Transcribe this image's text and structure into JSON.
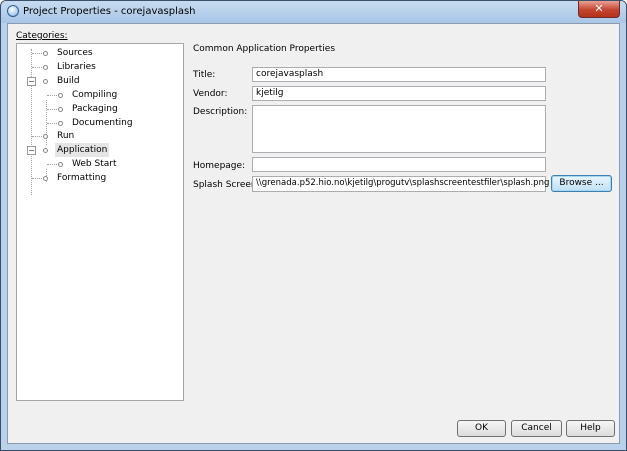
{
  "window": {
    "title": "Project Properties - corejavasplash",
    "close_glyph": "✕"
  },
  "categories": {
    "label": "Categories:",
    "items": [
      {
        "label": "Sources"
      },
      {
        "label": "Libraries"
      },
      {
        "label": "Build"
      },
      {
        "label": "Compiling"
      },
      {
        "label": "Packaging"
      },
      {
        "label": "Documenting"
      },
      {
        "label": "Run"
      },
      {
        "label": "Application"
      },
      {
        "label": "Web Start"
      },
      {
        "label": "Formatting"
      }
    ]
  },
  "panel": {
    "title": "Common Application Properties",
    "fields": {
      "title": {
        "label": "Title:",
        "value": "corejavasplash"
      },
      "vendor": {
        "label": "Vendor:",
        "value": "kjetilg"
      },
      "description": {
        "label": "Description:",
        "value": ""
      },
      "homepage": {
        "label": "Homepage:",
        "value": ""
      },
      "splash": {
        "label": "Splash Screen:",
        "value": "\\\\grenada.p52.hio.no\\kjetilg\\progutv\\splashscreentestfiler\\splash.png"
      }
    },
    "browse_label": "Browse ..."
  },
  "buttons": {
    "ok": "OK",
    "cancel": "Cancel",
    "help": "Help"
  }
}
